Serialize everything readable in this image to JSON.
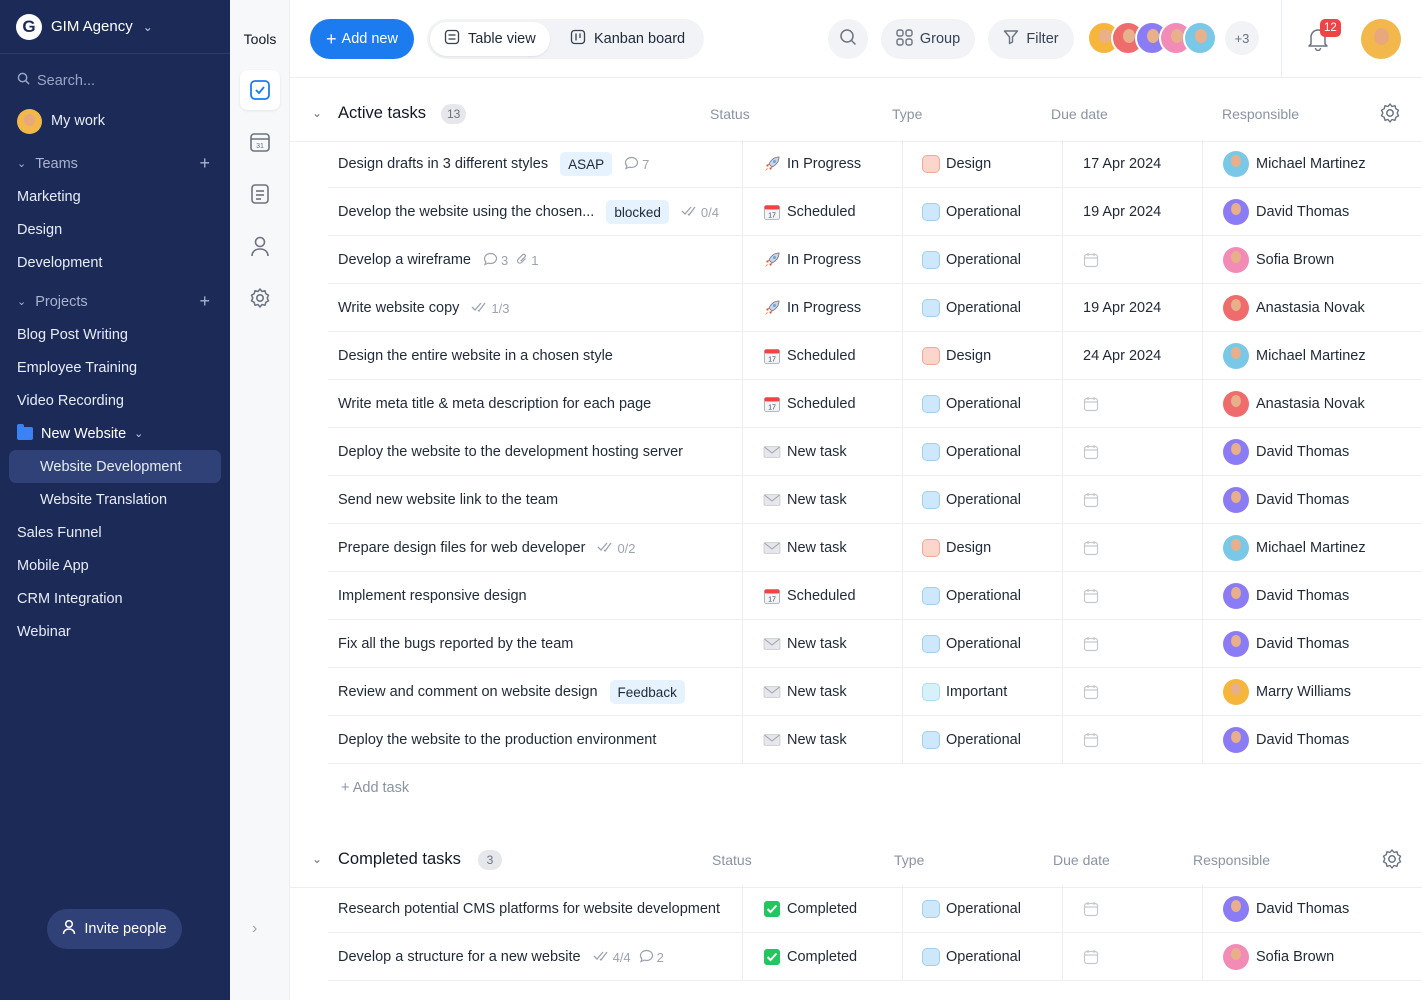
{
  "workspace": {
    "name": "GIM Agency",
    "logo_letter": "G"
  },
  "sidebar": {
    "search_placeholder": "Search...",
    "my_work": "My work",
    "teams_label": "Teams",
    "teams": [
      "Marketing",
      "Design",
      "Development"
    ],
    "projects_label": "Projects",
    "projects": [
      "Blog Post Writing",
      "Employee Training",
      "Video Recording"
    ],
    "folder": {
      "name": "New Website",
      "children": [
        "Website Development",
        "Website Translation"
      ],
      "active": "Website Development"
    },
    "projects_after": [
      "Sales Funnel",
      "Mobile App",
      "CRM Integration",
      "Webinar"
    ],
    "invite_label": "Invite people"
  },
  "tools": {
    "title": "Tools",
    "items": [
      "tasks-icon",
      "calendar-icon",
      "notes-icon",
      "person-icon",
      "settings-icon"
    ]
  },
  "toolbar": {
    "add_new": "Add new",
    "views": [
      "Table view",
      "Kanban board"
    ],
    "group": "Group",
    "filter": "Filter",
    "member_colors": [
      "#f5b63b",
      "#ef6c6c",
      "#8b7cf6",
      "#f28bb5",
      "#7ac8e8"
    ],
    "more_members": "+3",
    "notifications": "12"
  },
  "colors": {
    "accent": "#1d7bf0",
    "sidebar_bg": "#1b2a57"
  },
  "active": {
    "title": "Active tasks",
    "count": "13",
    "columns": [
      "Status",
      "Type",
      "Due date",
      "Responsible"
    ],
    "rows": [
      {
        "task": "Design drafts in 3 different styles",
        "tag": "ASAP",
        "tag_kind": "blue",
        "comments": "7",
        "status": "In Progress",
        "status_kind": "progress",
        "type": "Design",
        "type_kind": "design",
        "due": "17 Apr 2024",
        "resp": "Michael Martinez",
        "resp_color": "#7ac8e8"
      },
      {
        "task": "Develop the website using the chosen...",
        "tag": "blocked",
        "tag_kind": "blue",
        "checks": "0/4",
        "status": "Scheduled",
        "status_kind": "scheduled",
        "type": "Operational",
        "type_kind": "operational",
        "due": "19 Apr 2024",
        "resp": "David Thomas",
        "resp_color": "#8b7cf6"
      },
      {
        "task": "Develop a wireframe",
        "comments": "3",
        "attachments": "1",
        "status": "In Progress",
        "status_kind": "progress",
        "type": "Operational",
        "type_kind": "operational",
        "resp": "Sofia Brown",
        "resp_color": "#f28bb5"
      },
      {
        "task": "Write website copy",
        "checks": "1/3",
        "status": "In Progress",
        "status_kind": "progress",
        "type": "Operational",
        "type_kind": "operational",
        "due": "19 Apr 2024",
        "resp": "Anastasia Novak",
        "resp_color": "#ef6c6c"
      },
      {
        "task": "Design the entire website in a chosen style",
        "status": "Scheduled",
        "status_kind": "scheduled",
        "type": "Design",
        "type_kind": "design",
        "due": "24 Apr 2024",
        "resp": "Michael Martinez",
        "resp_color": "#7ac8e8"
      },
      {
        "task": "Write meta title & meta description for each page",
        "status": "Scheduled",
        "status_kind": "scheduled",
        "type": "Operational",
        "type_kind": "operational",
        "resp": "Anastasia Novak",
        "resp_color": "#ef6c6c"
      },
      {
        "task": "Deploy the website to the development hosting server",
        "status": "New task",
        "status_kind": "new",
        "type": "Operational",
        "type_kind": "operational",
        "resp": "David Thomas",
        "resp_color": "#8b7cf6"
      },
      {
        "task": "Send new website link to the team",
        "status": "New task",
        "status_kind": "new",
        "type": "Operational",
        "type_kind": "operational",
        "resp": "David Thomas",
        "resp_color": "#8b7cf6"
      },
      {
        "task": "Prepare design files for web developer",
        "checks": "0/2",
        "status": "New task",
        "status_kind": "new",
        "type": "Design",
        "type_kind": "design",
        "resp": "Michael Martinez",
        "resp_color": "#7ac8e8"
      },
      {
        "task": "Implement responsive design",
        "status": "Scheduled",
        "status_kind": "scheduled",
        "type": "Operational",
        "type_kind": "operational",
        "resp": "David Thomas",
        "resp_color": "#8b7cf6"
      },
      {
        "task": "Fix all the bugs reported by the team",
        "status": "New task",
        "status_kind": "new",
        "type": "Operational",
        "type_kind": "operational",
        "resp": "David Thomas",
        "resp_color": "#8b7cf6"
      },
      {
        "task": "Review and comment on website design",
        "tag": "Feedback",
        "tag_kind": "blue",
        "status": "New task",
        "status_kind": "new",
        "type": "Important",
        "type_kind": "important",
        "resp": "Marry Williams",
        "resp_color": "#f5b63b"
      },
      {
        "task": "Deploy the website to the production environment",
        "status": "New task",
        "status_kind": "new",
        "type": "Operational",
        "type_kind": "operational",
        "resp": "David Thomas",
        "resp_color": "#8b7cf6"
      }
    ],
    "add_task": "Add task"
  },
  "completed": {
    "title": "Completed tasks",
    "count": "3",
    "columns": [
      "Status",
      "Type",
      "Due date",
      "Responsible"
    ],
    "rows": [
      {
        "task": "Research potential CMS platforms for website development",
        "status": "Completed",
        "status_kind": "done",
        "type": "Operational",
        "type_kind": "operational",
        "resp": "David Thomas",
        "resp_color": "#8b7cf6"
      },
      {
        "task": "Develop a structure for a new website",
        "checks": "4/4",
        "comments": "2",
        "status": "Completed",
        "status_kind": "done",
        "type": "Operational",
        "type_kind": "operational",
        "resp": "Sofia Brown",
        "resp_color": "#f28bb5"
      }
    ]
  }
}
